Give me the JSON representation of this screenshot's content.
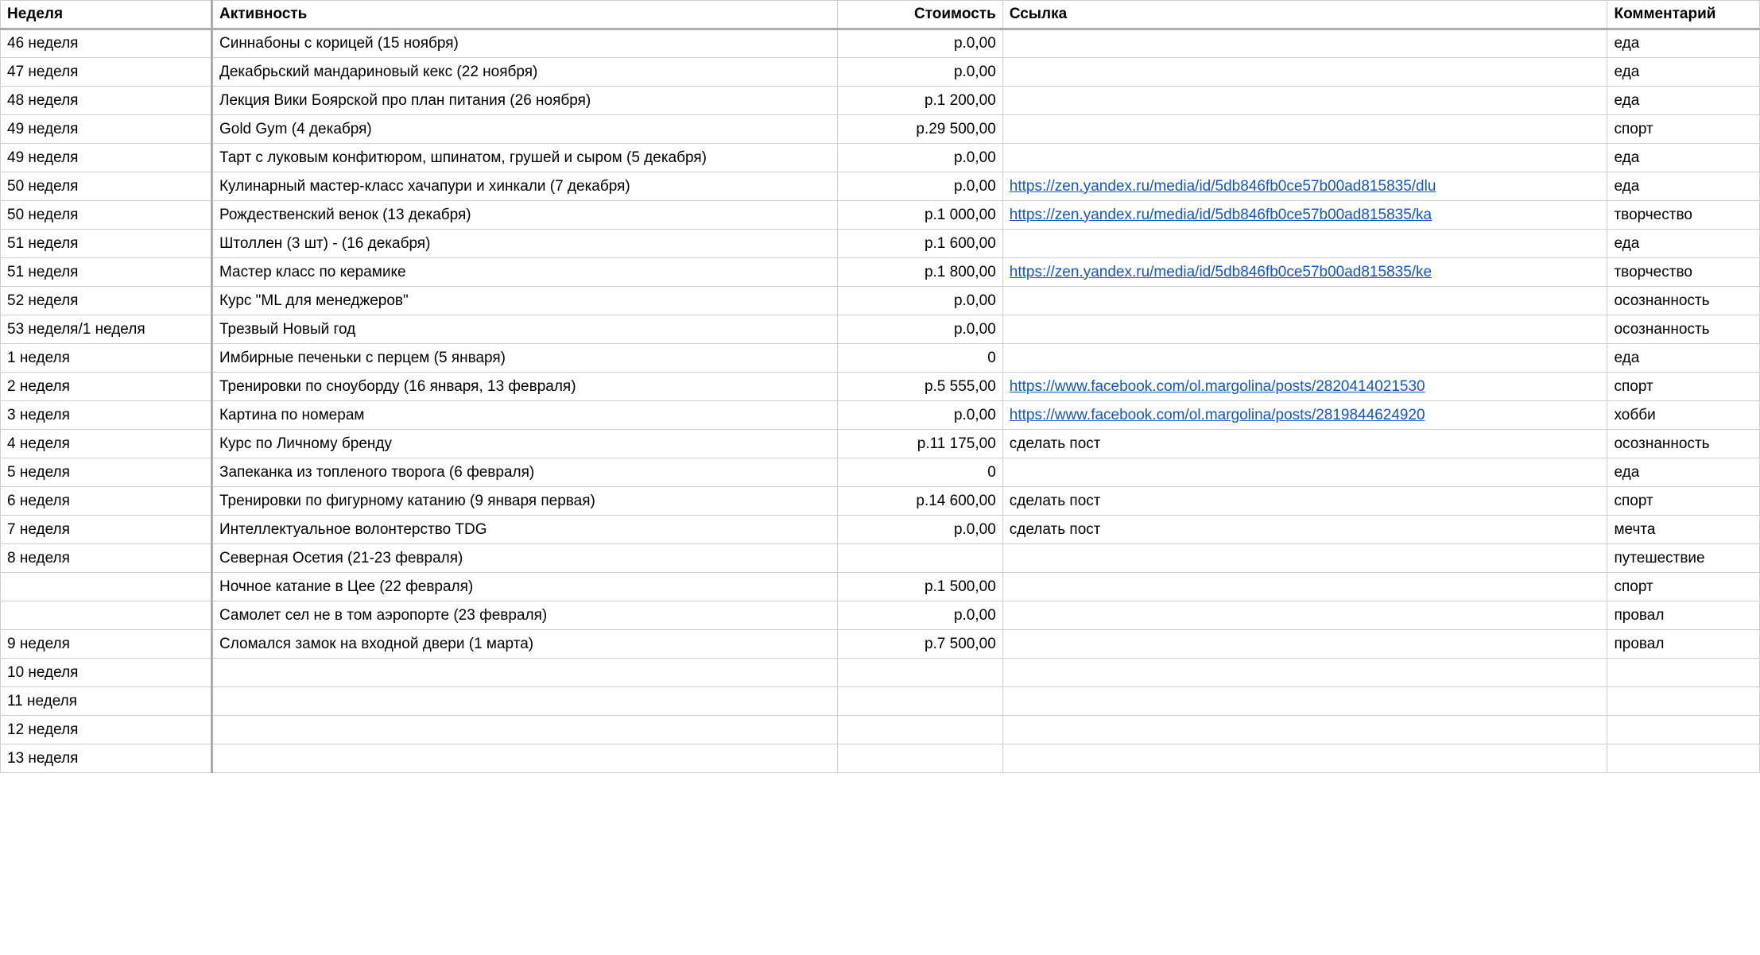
{
  "headers": {
    "week": "Неделя",
    "activity": "Активность",
    "cost": "Стоимость",
    "link": "Ссылка",
    "comment": "Комментарий"
  },
  "rows": [
    {
      "week": "46 неделя",
      "activity": "Синнабоны с корицей (15 ноября)",
      "cost": "р.0,00",
      "link": "",
      "linkType": "text",
      "comment": "еда"
    },
    {
      "week": "47 неделя",
      "activity": "Декабрьский мандариновый кекс (22 ноября)",
      "cost": "р.0,00",
      "link": "",
      "linkType": "text",
      "comment": "еда"
    },
    {
      "week": "48 неделя",
      "activity": "Лекция Вики Боярской про план питания (26 ноября)",
      "cost": "р.1 200,00",
      "link": "",
      "linkType": "text",
      "comment": "еда"
    },
    {
      "week": "49 неделя",
      "activity": "Gold Gym (4 декабря)",
      "cost": "р.29 500,00",
      "link": "",
      "linkType": "text",
      "comment": "спорт"
    },
    {
      "week": "49 неделя",
      "activity": "Тарт с луковым конфитюром, шпинатом, грушей и сыром (5 декабря)",
      "cost": "р.0,00",
      "link": "",
      "linkType": "text",
      "comment": "еда"
    },
    {
      "week": "50 неделя",
      "activity": "Кулинарный мастер-класс хачапури и хинкали (7 декабря)",
      "cost": "р.0,00",
      "link": "https://zen.yandex.ru/media/id/5db846fb0ce57b00ad815835/dlu",
      "linkType": "url",
      "comment": "еда"
    },
    {
      "week": "50 неделя",
      "activity": "Рождественский венок (13 декабря)",
      "cost": "р.1 000,00",
      "link": "https://zen.yandex.ru/media/id/5db846fb0ce57b00ad815835/ka",
      "linkType": "url",
      "comment": "творчество"
    },
    {
      "week": "51 неделя",
      "activity": "Штоллен (3 шт) - (16 декабря)",
      "cost": "р.1 600,00",
      "link": "",
      "linkType": "text",
      "comment": "еда"
    },
    {
      "week": "51 неделя",
      "activity": "Мастер класс по керамике",
      "cost": "р.1 800,00",
      "link": "https://zen.yandex.ru/media/id/5db846fb0ce57b00ad815835/ke",
      "linkType": "url",
      "comment": "творчество"
    },
    {
      "week": "52 неделя",
      "activity": "Курс \"ML для менеджеров\"",
      "cost": "р.0,00",
      "link": "",
      "linkType": "text",
      "comment": "осознанность"
    },
    {
      "week": "53 неделя/1 неделя",
      "activity": "Трезвый Новый год",
      "cost": "р.0,00",
      "link": "",
      "linkType": "text",
      "comment": "осознанность"
    },
    {
      "week": "1 неделя",
      "activity": "Имбирные печеньки с перцем (5 января)",
      "cost": "0",
      "link": "",
      "linkType": "text",
      "comment": "еда"
    },
    {
      "week": "2 неделя",
      "activity": "Тренировки по сноуборду (16 января, 13 февраля)",
      "cost": "р.5 555,00",
      "link": "https://www.facebook.com/ol.margolina/posts/2820414021530",
      "linkType": "url",
      "comment": "спорт"
    },
    {
      "week": "3 неделя",
      "activity": "Картина по номерам",
      "cost": "р.0,00",
      "link": "https://www.facebook.com/ol.margolina/posts/2819844624920",
      "linkType": "url",
      "comment": "хобби"
    },
    {
      "week": "4 неделя",
      "activity": "Курс по Личному бренду",
      "cost": "р.11 175,00",
      "link": "сделать пост",
      "linkType": "text",
      "comment": "осознанность"
    },
    {
      "week": "5 неделя",
      "activity": "Запеканка из топленого творога (6 февраля)",
      "cost": "0",
      "link": "",
      "linkType": "text",
      "comment": "еда"
    },
    {
      "week": "6 неделя",
      "activity": "Тренировки по фигурному катанию (9 января первая)",
      "cost": "р.14 600,00",
      "link": "сделать пост",
      "linkType": "text",
      "comment": "спорт"
    },
    {
      "week": "7 неделя",
      "activity": "Интеллектуальное волонтерство TDG",
      "cost": "р.0,00",
      "link": "сделать пост",
      "linkType": "text",
      "comment": "мечта"
    },
    {
      "week": "8 неделя",
      "activity": "Северная Осетия (21-23 февраля)",
      "cost": "",
      "link": "",
      "linkType": "text",
      "comment": "путешествие"
    },
    {
      "week": "",
      "activity": "Ночное катание в Цее (22 февраля)",
      "cost": "р.1 500,00",
      "link": "",
      "linkType": "text",
      "comment": "спорт"
    },
    {
      "week": "",
      "activity": "Самолет сел не в том аэропорте (23 февраля)",
      "cost": "р.0,00",
      "link": "",
      "linkType": "text",
      "comment": "провал"
    },
    {
      "week": "9 неделя",
      "activity": "Сломался замок на входной двери (1 марта)",
      "cost": "р.7 500,00",
      "link": "",
      "linkType": "text",
      "comment": "провал"
    },
    {
      "week": "10 неделя",
      "activity": "",
      "cost": "",
      "link": "",
      "linkType": "text",
      "comment": ""
    },
    {
      "week": "11 неделя",
      "activity": "",
      "cost": "",
      "link": "",
      "linkType": "text",
      "comment": ""
    },
    {
      "week": "12 неделя",
      "activity": "",
      "cost": "",
      "link": "",
      "linkType": "text",
      "comment": ""
    },
    {
      "week": "13 неделя",
      "activity": "",
      "cost": "",
      "link": "",
      "linkType": "text",
      "comment": ""
    }
  ]
}
